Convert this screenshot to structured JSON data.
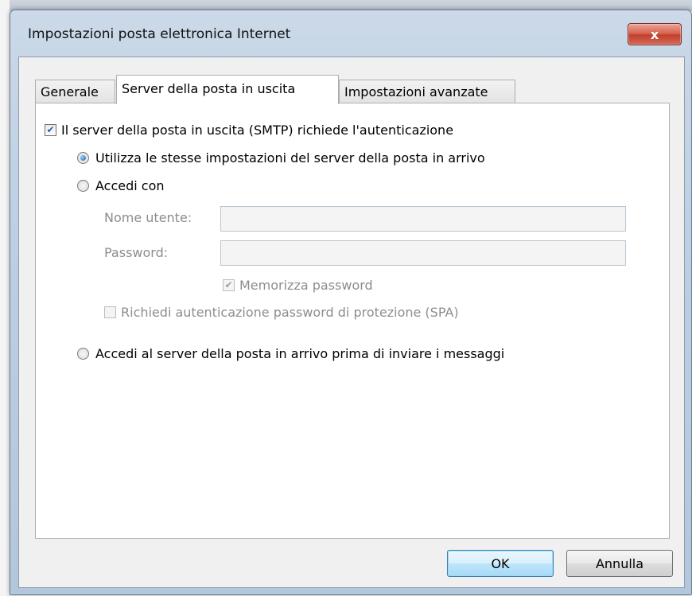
{
  "window": {
    "title": "Impostazioni posta elettronica Internet",
    "close_glyph": "x"
  },
  "tabs": [
    {
      "label": "Generale",
      "active": false
    },
    {
      "label": "Server della posta in uscita",
      "active": true
    },
    {
      "label": "Impostazioni avanzate",
      "active": false
    }
  ],
  "smtp_auth": {
    "label": "Il server della posta in uscita (SMTP) richiede l'autenticazione",
    "checked": true
  },
  "options": {
    "same_settings": {
      "label": "Utilizza le stesse impostazioni del server della posta in arrivo",
      "selected": true
    },
    "login_with": {
      "label": "Accedi con",
      "selected": false
    },
    "login_before_send": {
      "label": "Accedi al server della posta in arrivo prima di inviare i messaggi",
      "selected": false
    }
  },
  "credentials": {
    "username_label": "Nome utente:",
    "username_value": "",
    "password_label": "Password:",
    "password_value": "",
    "remember_password_label": "Memorizza password",
    "remember_password_checked": true,
    "spa_label": "Richiedi autenticazione password di protezione (SPA)",
    "spa_checked": false
  },
  "buttons": {
    "ok": "OK",
    "cancel": "Annulla"
  },
  "colors": {
    "accent": "#2a5fa8",
    "close_button": "#c2402b",
    "default_button": "#bee6fd"
  }
}
